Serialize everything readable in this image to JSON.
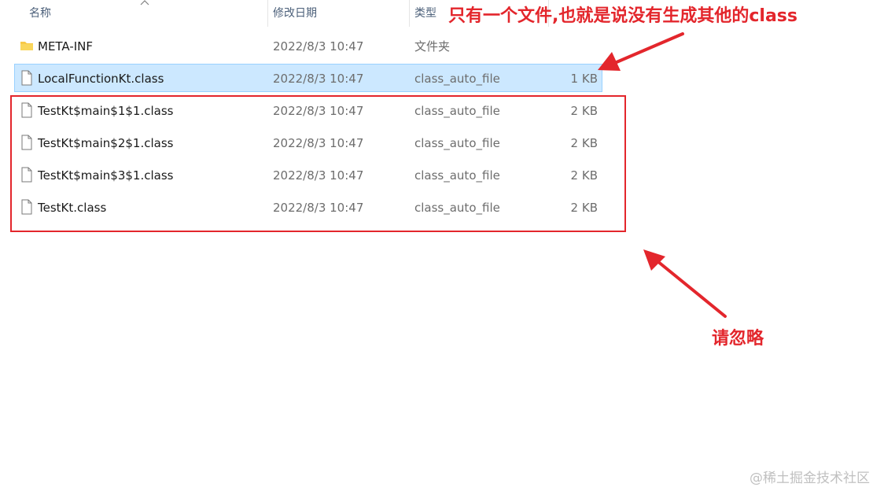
{
  "columns": {
    "name": "名称",
    "modified": "修改日期",
    "type": "类型"
  },
  "files": [
    {
      "name": "META-INF",
      "date": "2022/8/3 10:47",
      "type": "文件夹",
      "size": "",
      "icon": "folder-icon",
      "selected": false
    },
    {
      "name": "LocalFunctionKt.class",
      "date": "2022/8/3 10:47",
      "type": "class_auto_file",
      "size": "1 KB",
      "icon": "file-icon",
      "selected": true
    },
    {
      "name": "TestKt$main$1$1.class",
      "date": "2022/8/3 10:47",
      "type": "class_auto_file",
      "size": "2 KB",
      "icon": "file-icon",
      "selected": false
    },
    {
      "name": "TestKt$main$2$1.class",
      "date": "2022/8/3 10:47",
      "type": "class_auto_file",
      "size": "2 KB",
      "icon": "file-icon",
      "selected": false
    },
    {
      "name": "TestKt$main$3$1.class",
      "date": "2022/8/3 10:47",
      "type": "class_auto_file",
      "size": "2 KB",
      "icon": "file-icon",
      "selected": false
    },
    {
      "name": "TestKt.class",
      "date": "2022/8/3 10:47",
      "type": "class_auto_file",
      "size": "2 KB",
      "icon": "file-icon",
      "selected": false
    }
  ],
  "annotations": {
    "top": "只有一个文件,也就是说没有生成其他的class",
    "bottom": "请忽略",
    "color": "#e3262c"
  },
  "watermark": "@稀土掘金技术社区",
  "colors": {
    "selection": "#cce8ff",
    "selection_border": "#99d1ff",
    "folder": "#f7c948"
  }
}
